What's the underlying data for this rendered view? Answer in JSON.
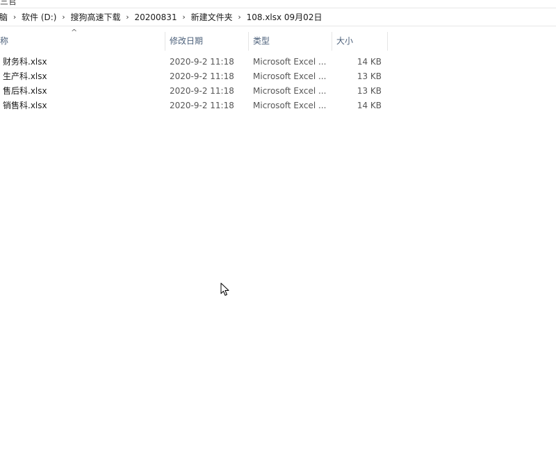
{
  "top_strip": {
    "glyph": "三官"
  },
  "breadcrumb": [
    {
      "label": "脑"
    },
    {
      "label": "软件 (D:)"
    },
    {
      "label": "搜狗高速下载"
    },
    {
      "label": "20200831"
    },
    {
      "label": "新建文件夹"
    },
    {
      "label": "108.xlsx 09月02日"
    }
  ],
  "columns": {
    "name": "称",
    "date": "修改日期",
    "type": "类型",
    "size": "大小"
  },
  "files": [
    {
      "name": "财务科.xlsx",
      "date": "2020-9-2 11:18",
      "type": "Microsoft Excel ...",
      "size": "14 KB"
    },
    {
      "name": "生产科.xlsx",
      "date": "2020-9-2 11:18",
      "type": "Microsoft Excel ...",
      "size": "13 KB"
    },
    {
      "name": "售后科.xlsx",
      "date": "2020-9-2 11:18",
      "type": "Microsoft Excel ...",
      "size": "13 KB"
    },
    {
      "name": "销售科.xlsx",
      "date": "2020-9-2 11:18",
      "type": "Microsoft Excel ...",
      "size": "14 KB"
    }
  ],
  "icons": {
    "sort": "sort-ascending-caret",
    "separator": "chevron-right",
    "cursor": "mouse-pointer"
  }
}
